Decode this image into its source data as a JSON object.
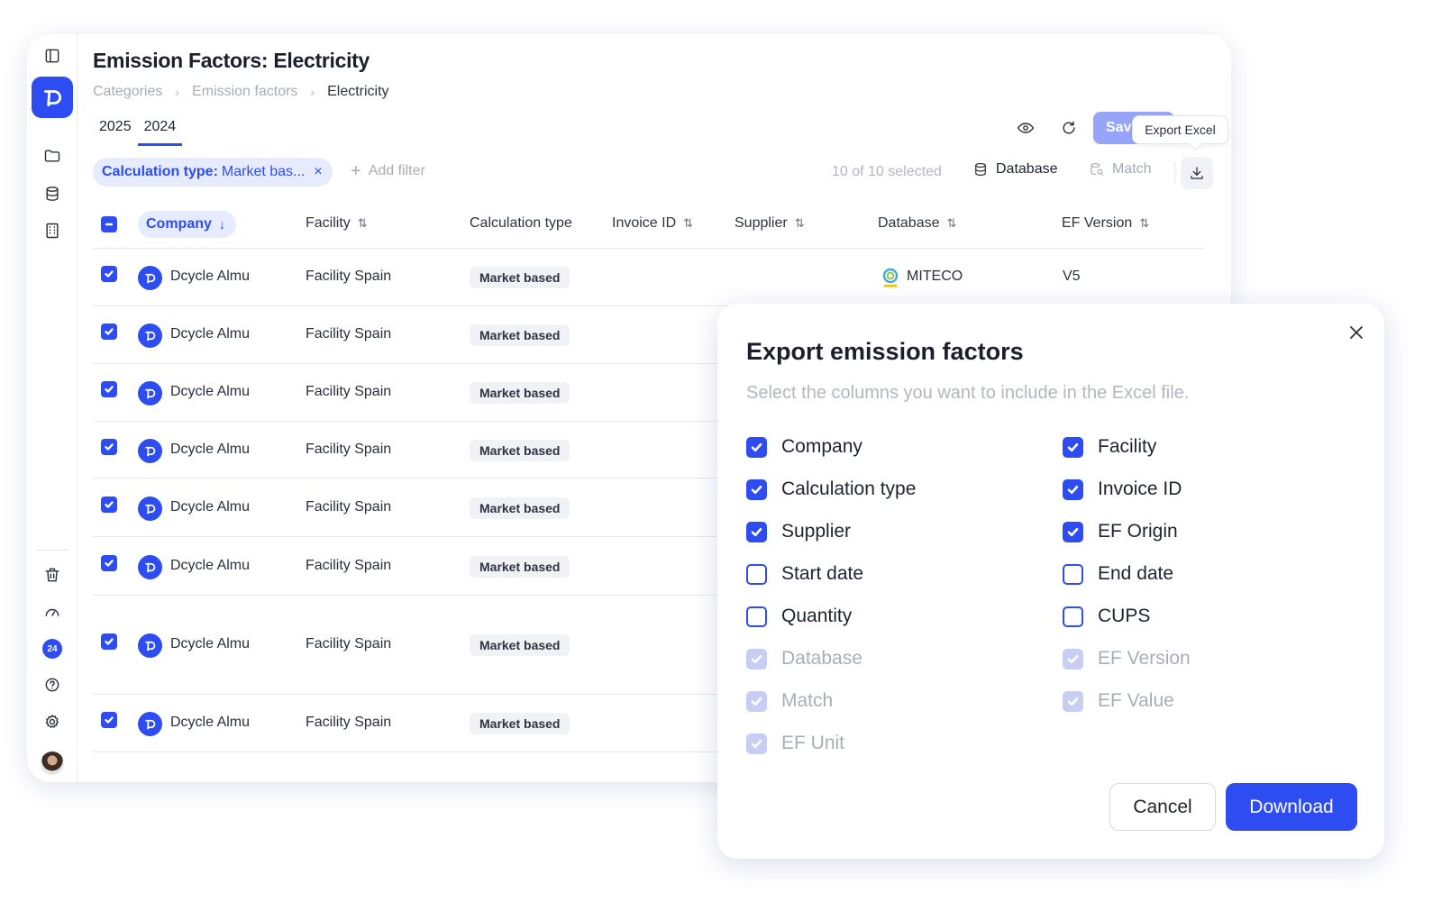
{
  "page": {
    "title": "Emission Factors: Electricity",
    "breadcrumb": [
      "Categories",
      "Emission factors",
      "Electricity"
    ],
    "tabs": [
      {
        "label": "2025",
        "active": false
      },
      {
        "label": "2024",
        "active": true
      }
    ]
  },
  "sidebar": {
    "icons": [
      "panel-toggle-icon",
      "dcycle-logo",
      "folder-icon",
      "database-icon",
      "building-icon",
      "trash-icon",
      "gauge-icon",
      "notifications-badge",
      "help-icon",
      "settings-icon",
      "avatar"
    ],
    "badge_count": "24"
  },
  "toolbar": {
    "save_label": "Sav",
    "tooltip": "Export Excel",
    "filter_key": "Calculation type:",
    "filter_value": "Market bas...",
    "filter_remove": "×",
    "add_filter": "Add filter",
    "selected_count": "10 of 10 selected",
    "database_label": "Database",
    "match_label": "Match"
  },
  "table": {
    "columns": {
      "company": "Company",
      "facility": "Facility",
      "calculation_type": "Calculation type",
      "invoice_id": "Invoice ID",
      "supplier": "Supplier",
      "database": "Database",
      "ef_version": "EF Version"
    },
    "rows": [
      {
        "company": "Dcycle Almu",
        "facility": "Facility Spain",
        "calculation_type": "Market based",
        "database": "MITECO",
        "ef_version": "V5",
        "checked": true
      },
      {
        "company": "Dcycle Almu",
        "facility": "Facility Spain",
        "calculation_type": "Market based",
        "checked": true
      },
      {
        "company": "Dcycle Almu",
        "facility": "Facility Spain",
        "calculation_type": "Market based",
        "checked": true
      },
      {
        "company": "Dcycle Almu",
        "facility": "Facility Spain",
        "calculation_type": "Market based",
        "checked": true
      },
      {
        "company": "Dcycle Almu",
        "facility": "Facility Spain",
        "calculation_type": "Market based",
        "checked": true
      },
      {
        "company": "Dcycle Almu",
        "facility": "Facility Spain",
        "calculation_type": "Market based",
        "checked": true
      },
      {
        "company": "Dcycle Almu",
        "facility": "Facility Spain",
        "calculation_type": "Market based",
        "checked": true
      },
      {
        "company": "Dcycle Almu",
        "facility": "Facility Spain",
        "calculation_type": "Market based",
        "checked": true
      }
    ]
  },
  "modal": {
    "title": "Export emission factors",
    "subtitle": "Select the columns you want to include in the Excel file.",
    "options": [
      {
        "label": "Company",
        "state": "checked"
      },
      {
        "label": "Facility",
        "state": "checked"
      },
      {
        "label": "Calculation type",
        "state": "checked"
      },
      {
        "label": "Invoice ID",
        "state": "checked"
      },
      {
        "label": "Supplier",
        "state": "checked"
      },
      {
        "label": "EF Origin",
        "state": "checked"
      },
      {
        "label": "Start date",
        "state": "unchecked"
      },
      {
        "label": "End date",
        "state": "unchecked"
      },
      {
        "label": "Quantity",
        "state": "unchecked"
      },
      {
        "label": "CUPS",
        "state": "unchecked"
      },
      {
        "label": "Database",
        "state": "disabled"
      },
      {
        "label": "EF Version",
        "state": "disabled"
      },
      {
        "label": "Match",
        "state": "disabled"
      },
      {
        "label": "EF Value",
        "state": "disabled"
      },
      {
        "label": "EF Unit",
        "state": "disabled"
      }
    ],
    "cancel_label": "Cancel",
    "download_label": "Download"
  },
  "colors": {
    "accent": "#2d4cf2",
    "accent_soft": "#e7ebfe",
    "accent_disabled": "#c8cdf4",
    "muted_text": "#a7abb6"
  }
}
